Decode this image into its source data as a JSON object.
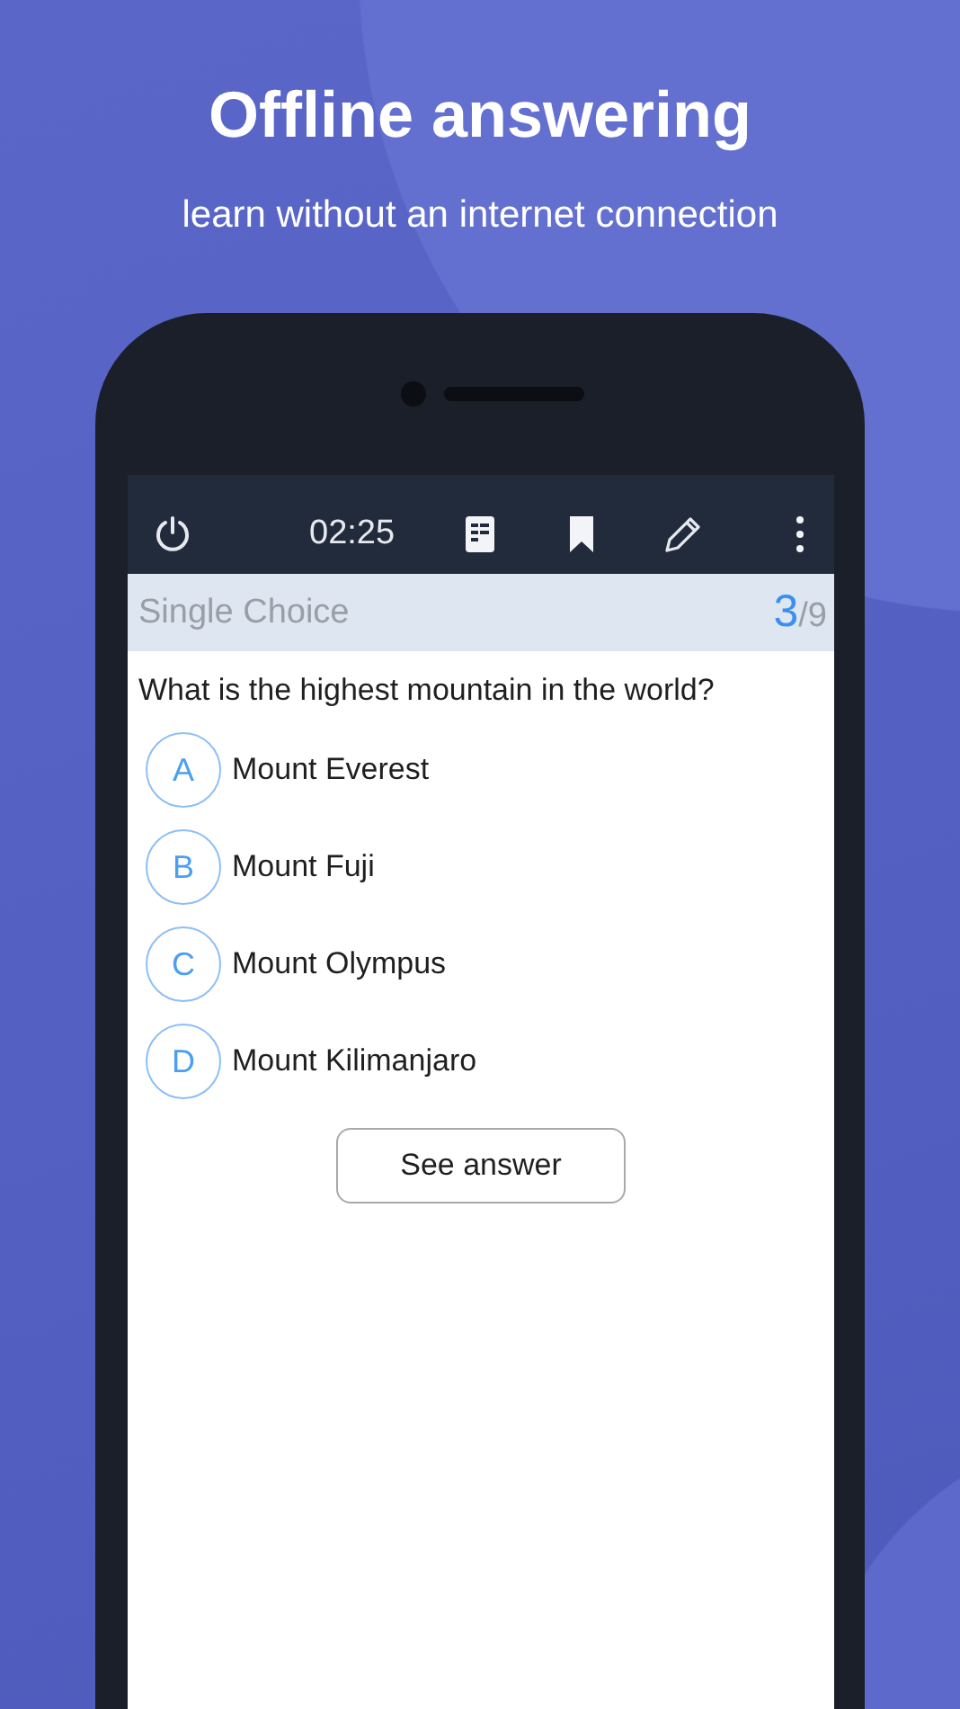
{
  "headline": {
    "title": "Offline answering",
    "subtitle": "learn without an internet connection"
  },
  "toolbar": {
    "timer": "02:25"
  },
  "question_header": {
    "type": "Single Choice",
    "current": "3",
    "total": "/9"
  },
  "question": "What is the highest mountain in the world?",
  "options": [
    {
      "letter": "A",
      "text": "Mount Everest"
    },
    {
      "letter": "B",
      "text": "Mount Fuji"
    },
    {
      "letter": "C",
      "text": "Mount Olympus"
    },
    {
      "letter": "D",
      "text": "Mount Kilimanjaro"
    }
  ],
  "button": "See answer"
}
